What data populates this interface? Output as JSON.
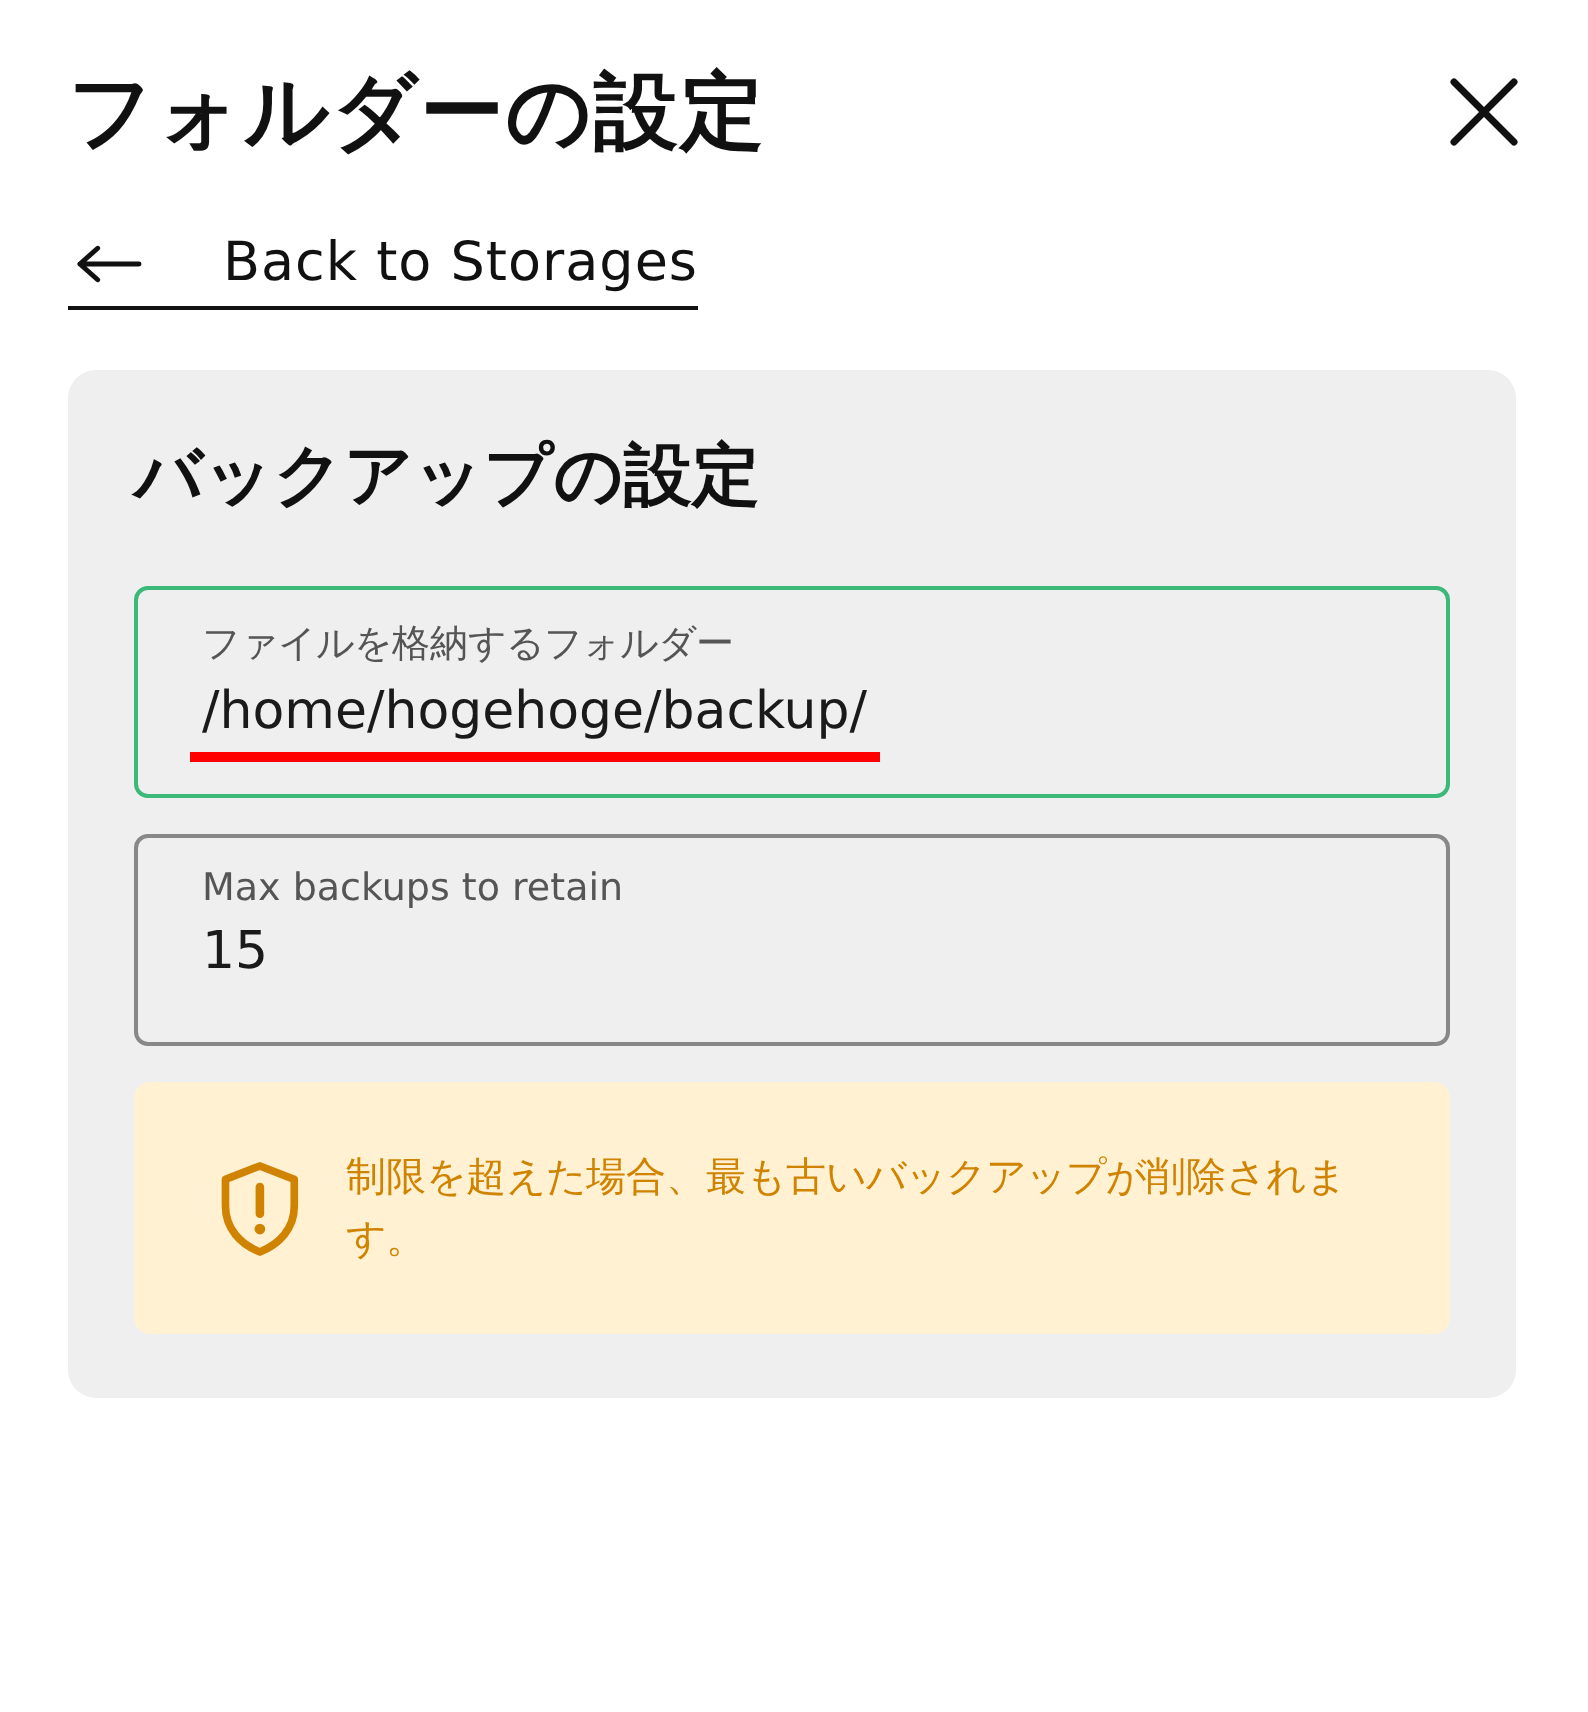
{
  "title": "フォルダーの設定",
  "back_link": {
    "label": "Back to Storages"
  },
  "card": {
    "title": "バックアップの設定",
    "fields": [
      {
        "label": "ファイルを格納するフォルダー",
        "value": "/home/hogehoge/backup/",
        "focused": true,
        "highlighted": true
      },
      {
        "label": "Max backups to retain",
        "value": "15",
        "focused": false,
        "highlighted": false
      }
    ],
    "warning": {
      "text": "制限を超えた場合、最も古いバックアップが削除されます。"
    }
  }
}
